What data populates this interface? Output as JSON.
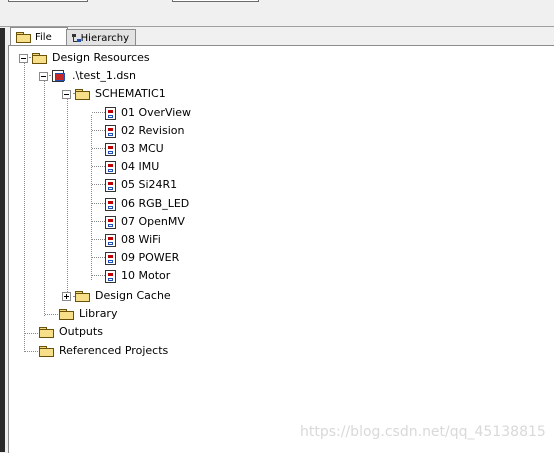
{
  "tabs": [
    {
      "label": "File",
      "icon": "folder-icon",
      "active": true
    },
    {
      "label": "Hierarchy",
      "icon": "hierarchy-icon",
      "active": false
    }
  ],
  "tree": {
    "design_resources": "Design Resources",
    "dsn_file": ".\\test_1.dsn",
    "schematic": "SCHEMATIC1",
    "pages": [
      "01 OverView",
      "02 Revision",
      "03 MCU",
      "04 IMU",
      "05 Si24R1",
      "06 RGB_LED",
      "07 OpenMV",
      "08 WiFi",
      "09 POWER",
      "10 Motor"
    ],
    "design_cache": "Design Cache",
    "library": "Library",
    "outputs": "Outputs",
    "referenced_projects": "Referenced Projects"
  },
  "watermark": "https://blog.csdn.net/qq_45138815",
  "colors": {
    "folder": "#f7de88",
    "page_red": "#c00000",
    "page_blue": "#1f4fb8"
  }
}
